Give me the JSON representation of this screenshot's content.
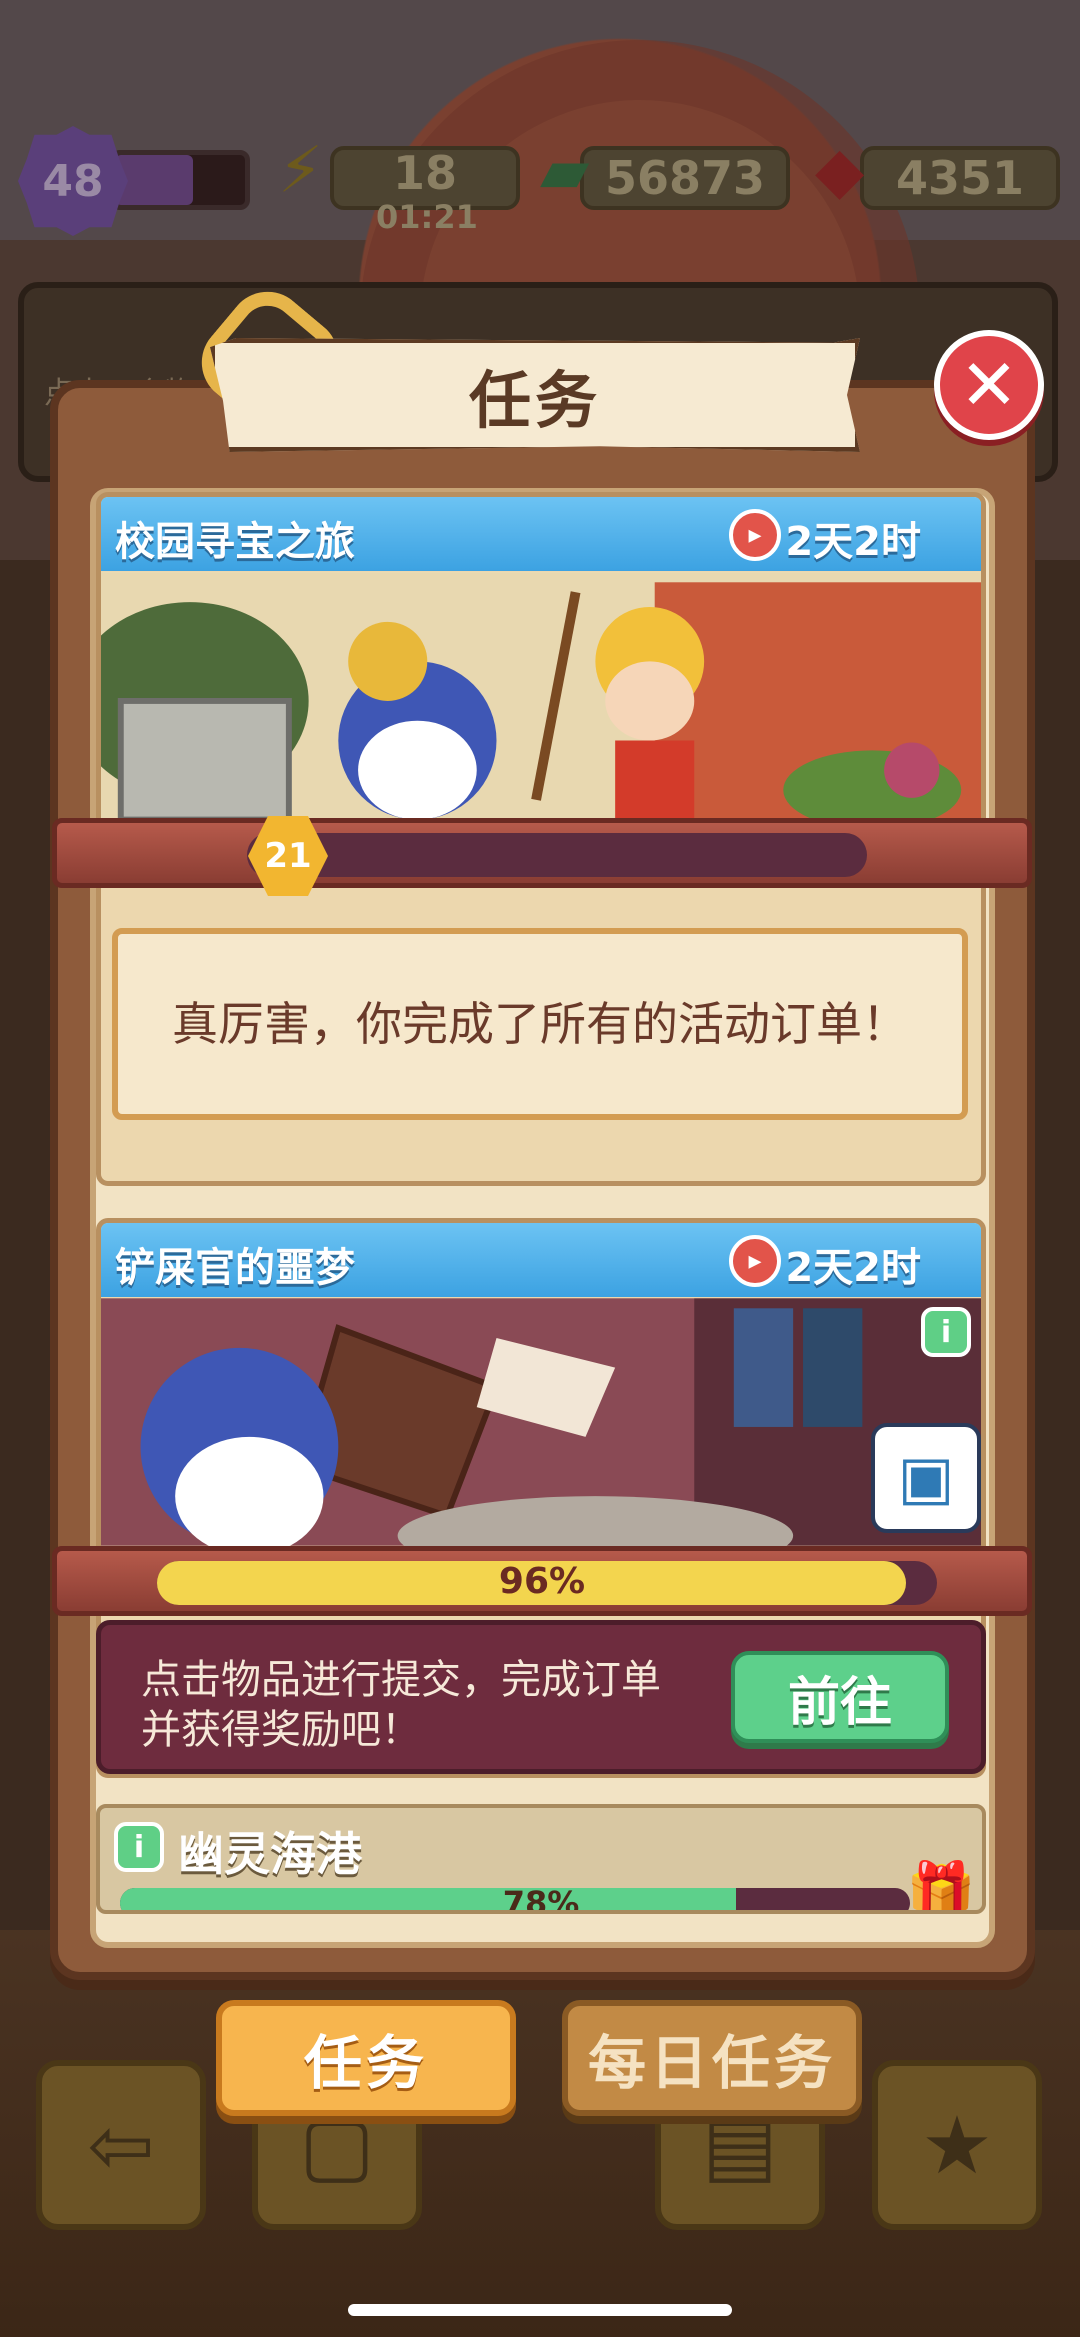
{
  "status": {
    "level": "48",
    "energy": "18",
    "energy_timer": "01:21",
    "cash": "56873",
    "gems": "4351"
  },
  "background_hint": "点击一个物",
  "modal": {
    "title": "任务",
    "close_icon": "close-icon"
  },
  "events": [
    {
      "title": "校园寻宝之旅",
      "time_left": "2天2时",
      "level": "21",
      "message": "真厉害，你完成了所有的活动订单！"
    },
    {
      "title": "铲屎官的噩梦",
      "time_left": "2天2时",
      "progress_label": "96%",
      "progress": 0.96,
      "submit_hint": "点击物品进行提交，完成订单并获得奖励吧！",
      "go_label": "前往"
    },
    {
      "title": "幽灵海港",
      "progress_label": "78%",
      "progress": 0.78
    }
  ],
  "tabs": {
    "tasks": "任务",
    "daily": "每日任务"
  },
  "colors": {
    "accent_blue": "#3ca2e2",
    "go_green": "#5dd08b",
    "tab_orange": "#f7b54e",
    "close_red": "#e0444a"
  }
}
